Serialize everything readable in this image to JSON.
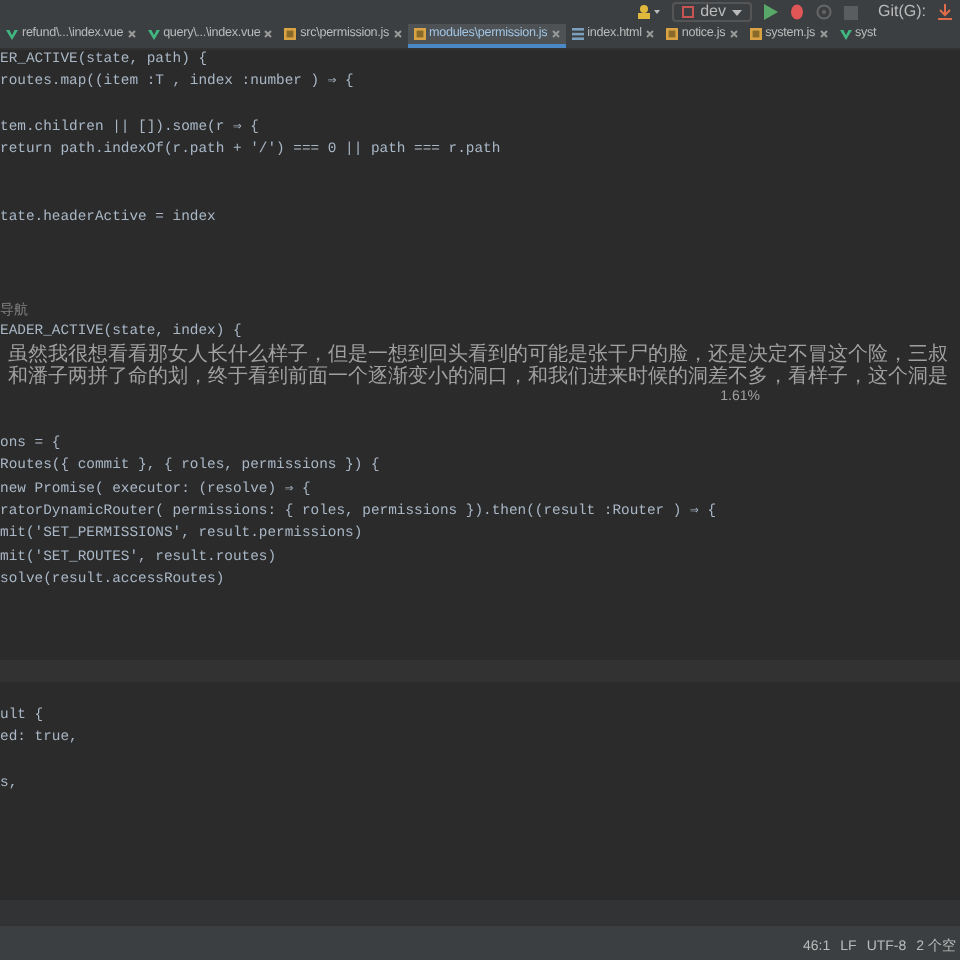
{
  "toolbar": {
    "run_config": "dev",
    "vcs_label": "Git(G):"
  },
  "tabs": [
    {
      "label": "refund\\...\\index.vue",
      "kind": "vue",
      "selected": false
    },
    {
      "label": "query\\...\\index.vue",
      "kind": "vue",
      "selected": false
    },
    {
      "label": "src\\permission.js",
      "kind": "js",
      "selected": false
    },
    {
      "label": "modules\\permission.js",
      "kind": "js",
      "selected": true
    },
    {
      "label": "index.html",
      "kind": "html",
      "selected": false
    },
    {
      "label": "notice.js",
      "kind": "js",
      "selected": false
    },
    {
      "label": "system.js",
      "kind": "js",
      "selected": false
    },
    {
      "label": "syst",
      "kind": "vue",
      "selected": false
    }
  ],
  "editor": {
    "lines": [
      {
        "kind": "code",
        "text": "ER_ACTIVE(state, path) {"
      },
      {
        "kind": "code",
        "text": "routes.map((item :T , index :number ) ⇒ {"
      },
      {
        "kind": "blank"
      },
      {
        "kind": "code",
        "text": "tem.children || []).some(r ⇒ {"
      },
      {
        "kind": "code",
        "text": "return path.indexOf(r.path + '/') === 0 || path === r.path"
      },
      {
        "kind": "blank"
      },
      {
        "kind": "blank"
      },
      {
        "kind": "code",
        "text": "tate.headerActive = index"
      },
      {
        "kind": "blank"
      },
      {
        "kind": "blank"
      },
      {
        "kind": "blank"
      },
      {
        "kind": "comment",
        "text": "导航"
      },
      {
        "kind": "code",
        "text": "EADER_ACTIVE(state, index) {"
      },
      {
        "kind": "popup",
        "text": "虽然我很想看看那女人长什么样子，但是一想到回头看到的可能是张干尸的脸，还是决定不冒这个险，三叔和潘子两拼了命的划，终于看到前面一个逐渐变小的洞口，和我们进来时候的洞差不多，看样子，这个洞是",
        "percent": "1.61%"
      },
      {
        "kind": "code",
        "text": "ons = {"
      },
      {
        "kind": "code",
        "text": "Routes({ commit }, { roles, permissions }) {"
      },
      {
        "kind": "code",
        "text": "new Promise( executor: (resolve) ⇒ {"
      },
      {
        "kind": "code",
        "text": "ratorDynamicRouter( permissions: { roles, permissions }).then((result :Router ) ⇒ {"
      },
      {
        "kind": "code",
        "text": "mit('SET_PERMISSIONS', result.permissions)"
      },
      {
        "kind": "code",
        "text": "mit('SET_ROUTES', result.routes)"
      },
      {
        "kind": "code",
        "text": "solve(result.accessRoutes)"
      },
      {
        "kind": "blank"
      },
      {
        "kind": "blank"
      },
      {
        "kind": "blank"
      },
      {
        "kind": "current"
      },
      {
        "kind": "blank"
      },
      {
        "kind": "code",
        "text": "ult {"
      },
      {
        "kind": "code",
        "text": "ed: true,"
      },
      {
        "kind": "blank"
      },
      {
        "kind": "code",
        "text": "s,"
      }
    ]
  },
  "status_bar": {
    "items": [
      "46:1",
      "LF",
      "UTF-8",
      "2 个空"
    ]
  }
}
